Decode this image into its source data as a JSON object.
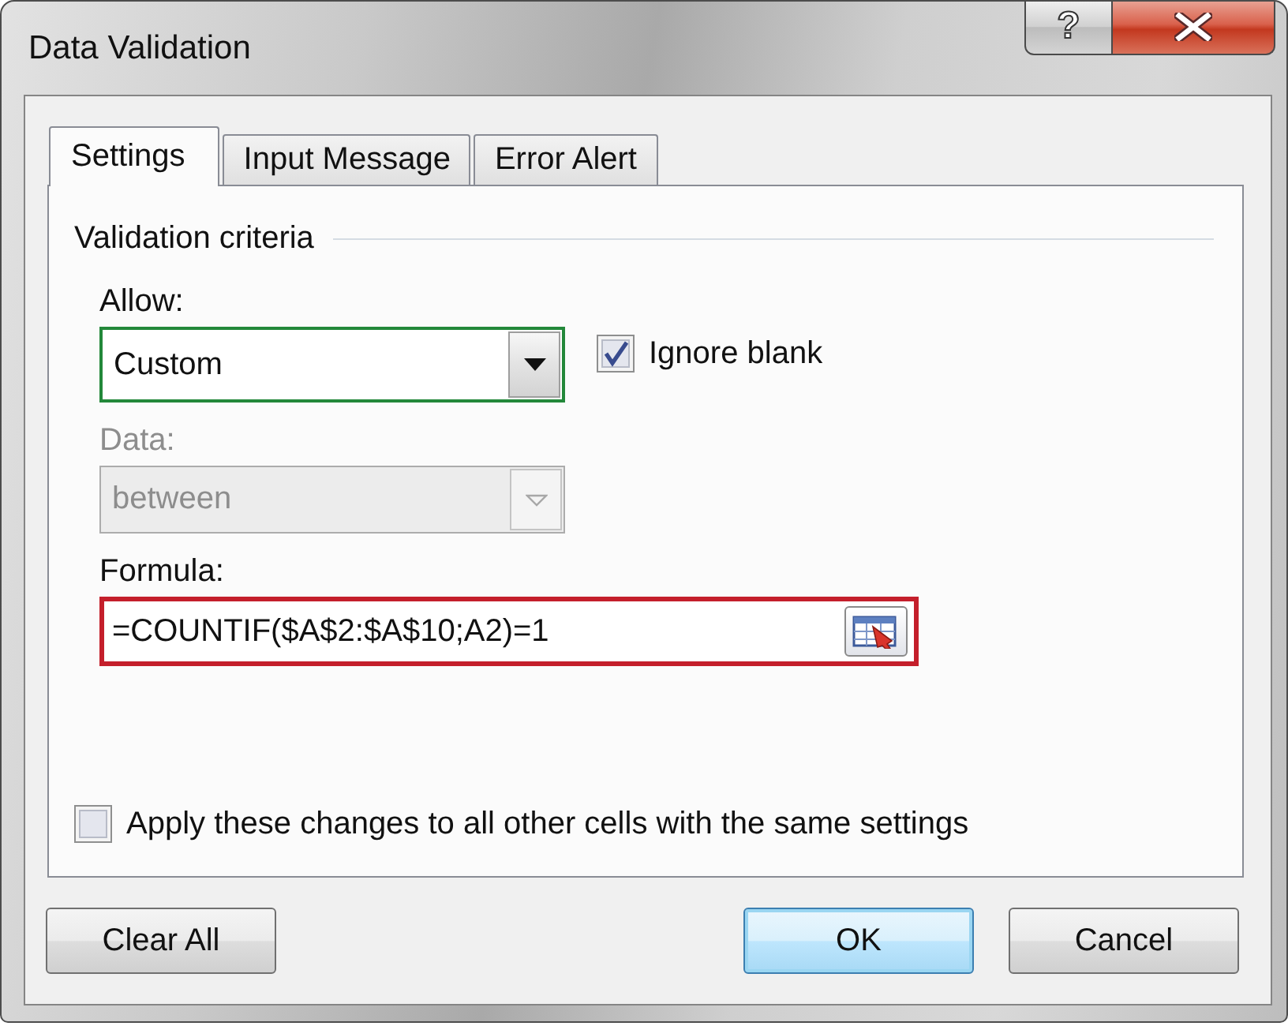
{
  "window": {
    "title": "Data Validation",
    "help_label": "?"
  },
  "tabs": [
    {
      "label": "Settings",
      "selected": true
    },
    {
      "label": "Input Message",
      "selected": false
    },
    {
      "label": "Error Alert",
      "selected": false
    }
  ],
  "group": {
    "title": "Validation criteria"
  },
  "fields": [
    {
      "kind": "dropdown",
      "label": "Allow:",
      "value": "Custom",
      "disabled": false,
      "color": "#23883a"
    },
    {
      "kind": "dropdown",
      "label": "Data:",
      "value": "between",
      "disabled": true
    },
    {
      "kind": "formula",
      "label": "Formula:",
      "value": "=COUNTIF($A$2:$A$10;A2)=1",
      "disabled": false,
      "color": "#c41f2b"
    }
  ],
  "ignore_blank": {
    "label": "Ignore blank",
    "checked": true
  },
  "apply_all": {
    "label": "Apply these changes to all other cells with the same settings",
    "checked": false
  },
  "buttons": [
    {
      "label": "Clear All",
      "focused": false
    },
    {
      "label": "OK",
      "focused": true
    },
    {
      "label": "Cancel",
      "focused": false
    }
  ]
}
